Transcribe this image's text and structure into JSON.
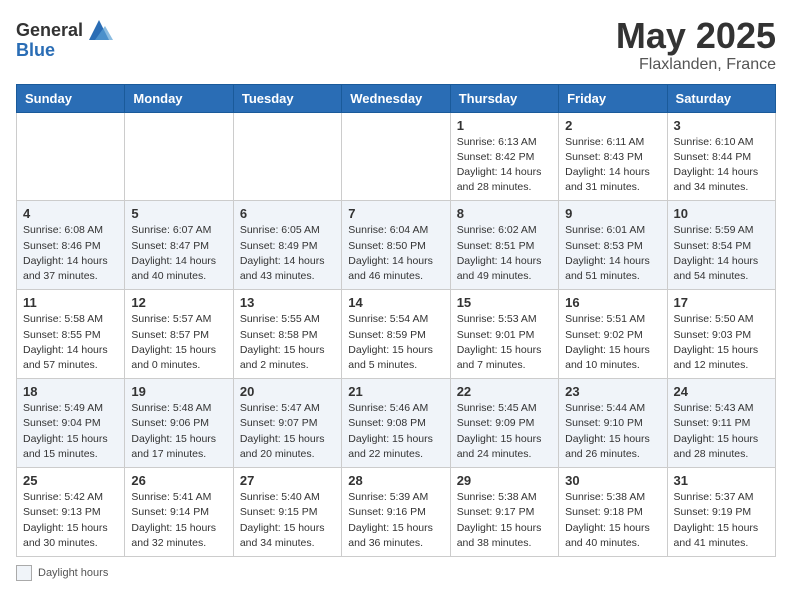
{
  "header": {
    "logo_general": "General",
    "logo_blue": "Blue",
    "title": "May 2025",
    "subtitle": "Flaxlanden, France"
  },
  "calendar": {
    "weekdays": [
      "Sunday",
      "Monday",
      "Tuesday",
      "Wednesday",
      "Thursday",
      "Friday",
      "Saturday"
    ],
    "weeks": [
      [
        {
          "day": "",
          "info": ""
        },
        {
          "day": "",
          "info": ""
        },
        {
          "day": "",
          "info": ""
        },
        {
          "day": "",
          "info": ""
        },
        {
          "day": "1",
          "info": "Sunrise: 6:13 AM\nSunset: 8:42 PM\nDaylight: 14 hours and 28 minutes."
        },
        {
          "day": "2",
          "info": "Sunrise: 6:11 AM\nSunset: 8:43 PM\nDaylight: 14 hours and 31 minutes."
        },
        {
          "day": "3",
          "info": "Sunrise: 6:10 AM\nSunset: 8:44 PM\nDaylight: 14 hours and 34 minutes."
        }
      ],
      [
        {
          "day": "4",
          "info": "Sunrise: 6:08 AM\nSunset: 8:46 PM\nDaylight: 14 hours and 37 minutes."
        },
        {
          "day": "5",
          "info": "Sunrise: 6:07 AM\nSunset: 8:47 PM\nDaylight: 14 hours and 40 minutes."
        },
        {
          "day": "6",
          "info": "Sunrise: 6:05 AM\nSunset: 8:49 PM\nDaylight: 14 hours and 43 minutes."
        },
        {
          "day": "7",
          "info": "Sunrise: 6:04 AM\nSunset: 8:50 PM\nDaylight: 14 hours and 46 minutes."
        },
        {
          "day": "8",
          "info": "Sunrise: 6:02 AM\nSunset: 8:51 PM\nDaylight: 14 hours and 49 minutes."
        },
        {
          "day": "9",
          "info": "Sunrise: 6:01 AM\nSunset: 8:53 PM\nDaylight: 14 hours and 51 minutes."
        },
        {
          "day": "10",
          "info": "Sunrise: 5:59 AM\nSunset: 8:54 PM\nDaylight: 14 hours and 54 minutes."
        }
      ],
      [
        {
          "day": "11",
          "info": "Sunrise: 5:58 AM\nSunset: 8:55 PM\nDaylight: 14 hours and 57 minutes."
        },
        {
          "day": "12",
          "info": "Sunrise: 5:57 AM\nSunset: 8:57 PM\nDaylight: 15 hours and 0 minutes."
        },
        {
          "day": "13",
          "info": "Sunrise: 5:55 AM\nSunset: 8:58 PM\nDaylight: 15 hours and 2 minutes."
        },
        {
          "day": "14",
          "info": "Sunrise: 5:54 AM\nSunset: 8:59 PM\nDaylight: 15 hours and 5 minutes."
        },
        {
          "day": "15",
          "info": "Sunrise: 5:53 AM\nSunset: 9:01 PM\nDaylight: 15 hours and 7 minutes."
        },
        {
          "day": "16",
          "info": "Sunrise: 5:51 AM\nSunset: 9:02 PM\nDaylight: 15 hours and 10 minutes."
        },
        {
          "day": "17",
          "info": "Sunrise: 5:50 AM\nSunset: 9:03 PM\nDaylight: 15 hours and 12 minutes."
        }
      ],
      [
        {
          "day": "18",
          "info": "Sunrise: 5:49 AM\nSunset: 9:04 PM\nDaylight: 15 hours and 15 minutes."
        },
        {
          "day": "19",
          "info": "Sunrise: 5:48 AM\nSunset: 9:06 PM\nDaylight: 15 hours and 17 minutes."
        },
        {
          "day": "20",
          "info": "Sunrise: 5:47 AM\nSunset: 9:07 PM\nDaylight: 15 hours and 20 minutes."
        },
        {
          "day": "21",
          "info": "Sunrise: 5:46 AM\nSunset: 9:08 PM\nDaylight: 15 hours and 22 minutes."
        },
        {
          "day": "22",
          "info": "Sunrise: 5:45 AM\nSunset: 9:09 PM\nDaylight: 15 hours and 24 minutes."
        },
        {
          "day": "23",
          "info": "Sunrise: 5:44 AM\nSunset: 9:10 PM\nDaylight: 15 hours and 26 minutes."
        },
        {
          "day": "24",
          "info": "Sunrise: 5:43 AM\nSunset: 9:11 PM\nDaylight: 15 hours and 28 minutes."
        }
      ],
      [
        {
          "day": "25",
          "info": "Sunrise: 5:42 AM\nSunset: 9:13 PM\nDaylight: 15 hours and 30 minutes."
        },
        {
          "day": "26",
          "info": "Sunrise: 5:41 AM\nSunset: 9:14 PM\nDaylight: 15 hours and 32 minutes."
        },
        {
          "day": "27",
          "info": "Sunrise: 5:40 AM\nSunset: 9:15 PM\nDaylight: 15 hours and 34 minutes."
        },
        {
          "day": "28",
          "info": "Sunrise: 5:39 AM\nSunset: 9:16 PM\nDaylight: 15 hours and 36 minutes."
        },
        {
          "day": "29",
          "info": "Sunrise: 5:38 AM\nSunset: 9:17 PM\nDaylight: 15 hours and 38 minutes."
        },
        {
          "day": "30",
          "info": "Sunrise: 5:38 AM\nSunset: 9:18 PM\nDaylight: 15 hours and 40 minutes."
        },
        {
          "day": "31",
          "info": "Sunrise: 5:37 AM\nSunset: 9:19 PM\nDaylight: 15 hours and 41 minutes."
        }
      ]
    ]
  },
  "footer": {
    "legend_label": "Daylight hours"
  }
}
